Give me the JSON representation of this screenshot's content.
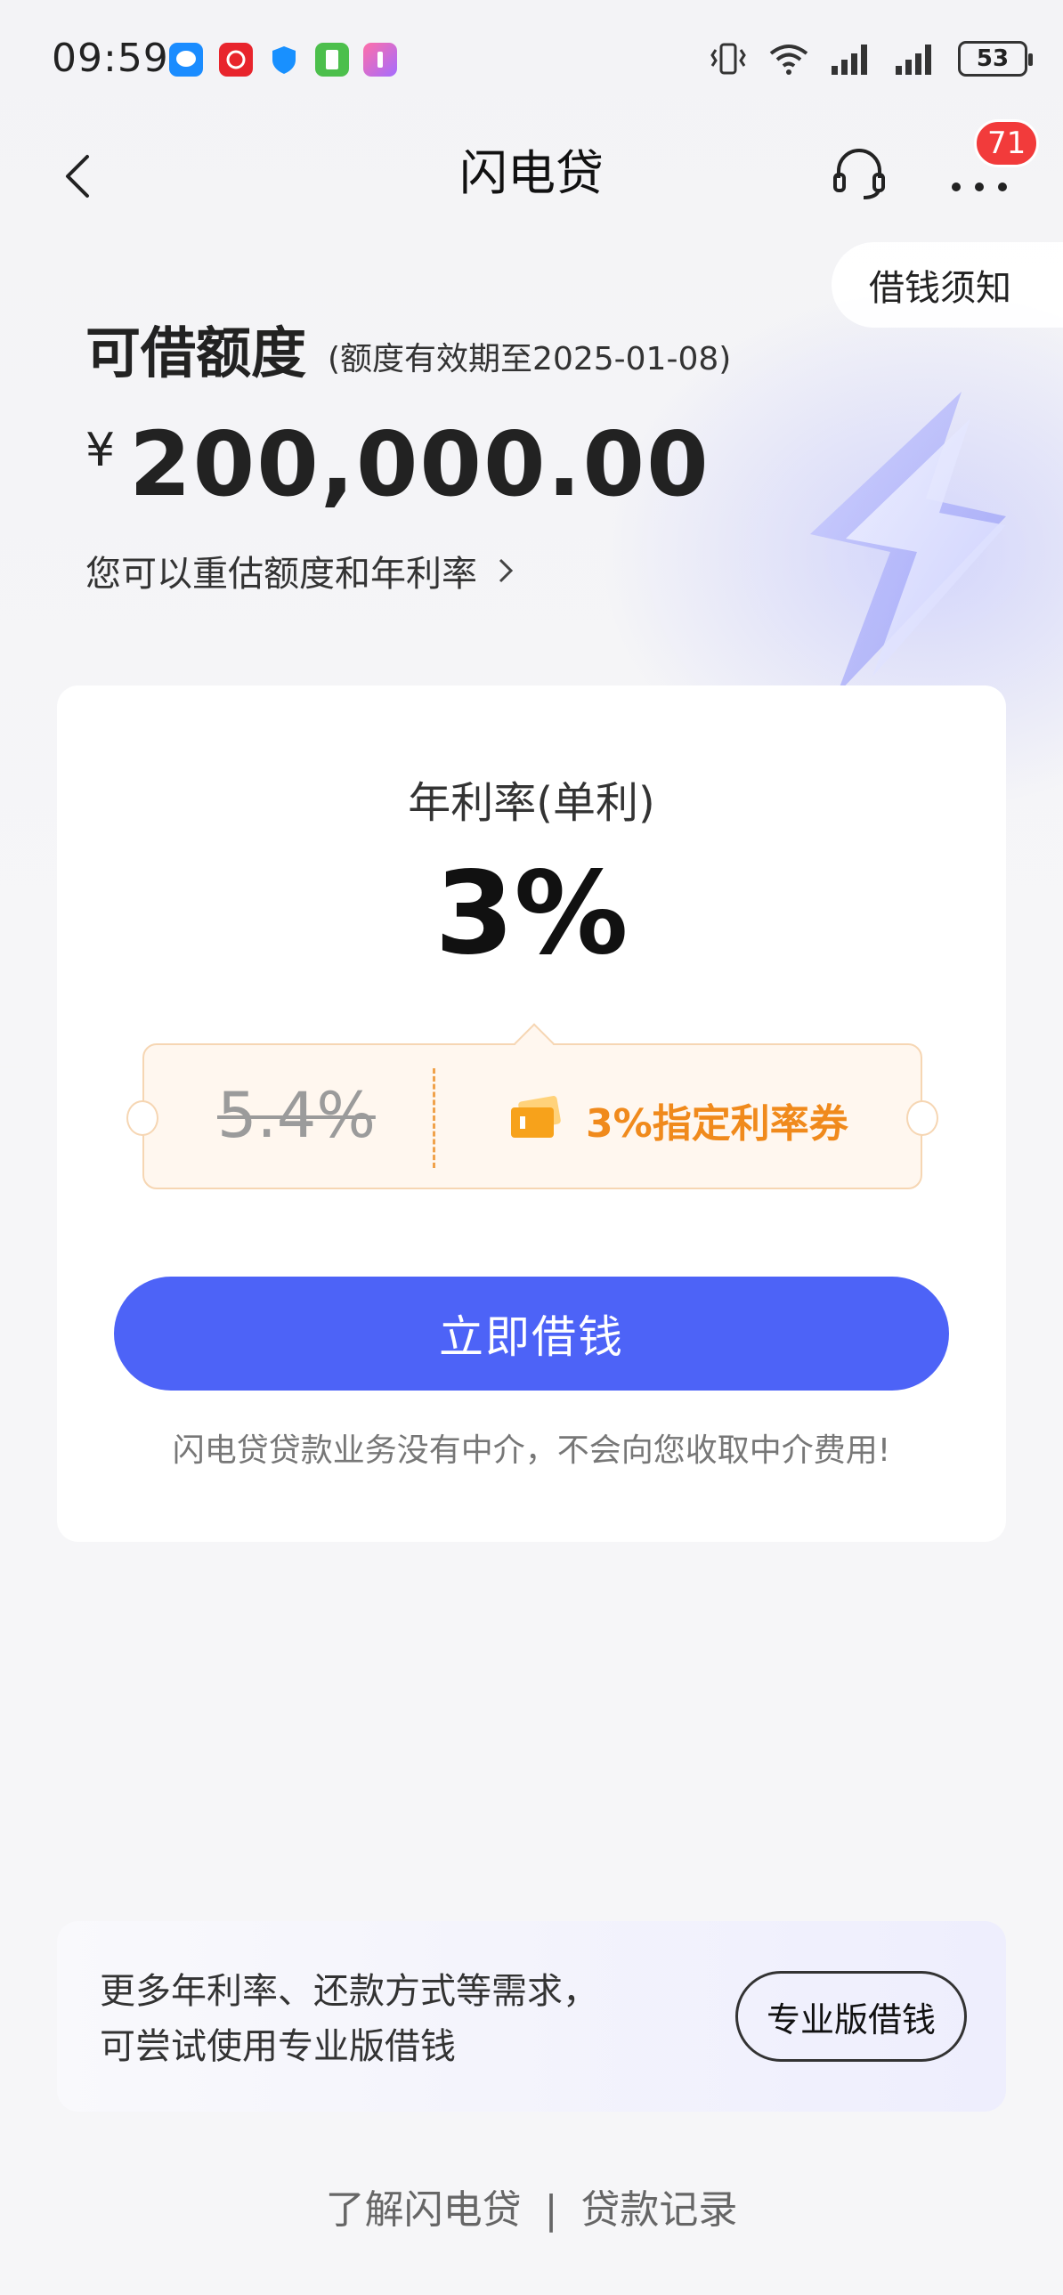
{
  "status_bar": {
    "time": "09:59",
    "battery": "53",
    "app_icons": [
      {
        "name": "messages-icon",
        "color": "#1a8cff"
      },
      {
        "name": "app-red-icon",
        "color": "#e8242c"
      },
      {
        "name": "shield-app-icon",
        "color": "#1890ff"
      },
      {
        "name": "sim-app-icon",
        "color": "#4cbf4c"
      },
      {
        "name": "app-gradient-icon",
        "color": "#ff6fa8"
      }
    ]
  },
  "nav": {
    "title": "闪电贷",
    "badge_count": "71"
  },
  "notice_tab": "借钱须知",
  "credit": {
    "label": "可借额度",
    "expiry": "(额度有效期至2025-01-08)",
    "currency": "¥",
    "amount": "200,000.00",
    "reassess": "您可以重估额度和年利率"
  },
  "card": {
    "rate_label": "年利率(单利)",
    "rate_value": "3%",
    "old_rate": "5.4%",
    "coupon_text": "3%指定利率券",
    "borrow_button": "立即借钱",
    "disclaimer": "闪电贷贷款业务没有中介，不会向您收取中介费用!"
  },
  "promo": {
    "line1": "更多年利率、还款方式等需求，",
    "line2": "可尝试使用专业版借钱",
    "button": "专业版借钱"
  },
  "footer": {
    "link1": "了解闪电贷",
    "separator": "|",
    "link2": "贷款记录"
  },
  "colors": {
    "primary": "#4d63f7",
    "coupon_accent": "#f08a1c",
    "badge": "#f23b3b"
  }
}
